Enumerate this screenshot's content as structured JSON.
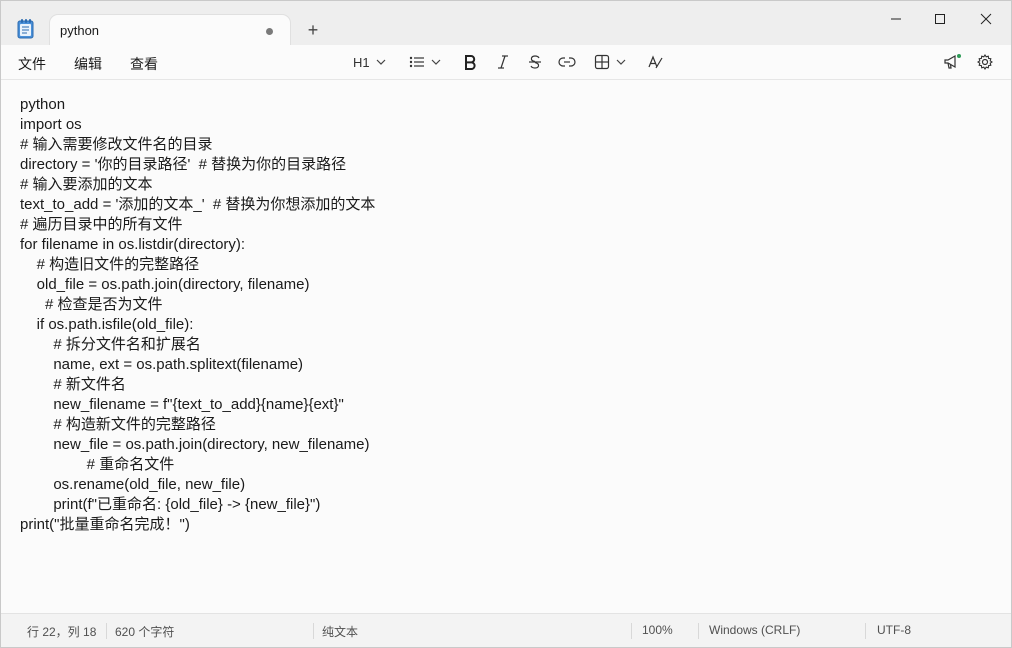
{
  "window": {
    "tab_title": "python",
    "new_tab_glyph": "+",
    "controls": [
      "minimize-icon",
      "maximize-icon",
      "close-icon"
    ]
  },
  "menu": {
    "file": "文件",
    "edit": "编辑",
    "view": "查看"
  },
  "toolbar": {
    "heading_label": "H1",
    "tools": [
      "heading-dropdown",
      "list-icon",
      "bold-icon",
      "italic-icon",
      "strikethrough-icon",
      "link-icon",
      "table-icon",
      "clear-format-icon",
      "announcement-icon",
      "settings-icon"
    ]
  },
  "editor": {
    "lines": [
      "python",
      "import os",
      "# 输入需要修改文件名的目录",
      "directory = '你的目录路径'  # 替换为你的目录路径",
      "# 输入要添加的文本",
      "text_to_add = '添加的文本_'  # 替换为你想添加的文本",
      "# 遍历目录中的所有文件",
      "for filename in os.listdir(directory):",
      "    # 构造旧文件的完整路径",
      "    old_file = os.path.join(directory, filename)",
      "      # 检查是否为文件",
      "    if os.path.isfile(old_file):",
      "        # 拆分文件名和扩展名",
      "        name, ext = os.path.splitext(filename)",
      "        # 新文件名",
      "        new_filename = f\"{text_to_add}{name}{ext}\"",
      "        # 构造新文件的完整路径",
      "        new_file = os.path.join(directory, new_filename)",
      "                # 重命名文件",
      "        os.rename(old_file, new_file)",
      "        print(f\"已重命名: {old_file} -> {new_file}\")",
      "print(\"批量重命名完成！\")"
    ]
  },
  "status": {
    "position": "行 22，列 18",
    "char_count": "620 个字符",
    "format": "纯文本",
    "zoom": "100%",
    "line_ending": "Windows (CRLF)",
    "encoding": "UTF-8"
  }
}
